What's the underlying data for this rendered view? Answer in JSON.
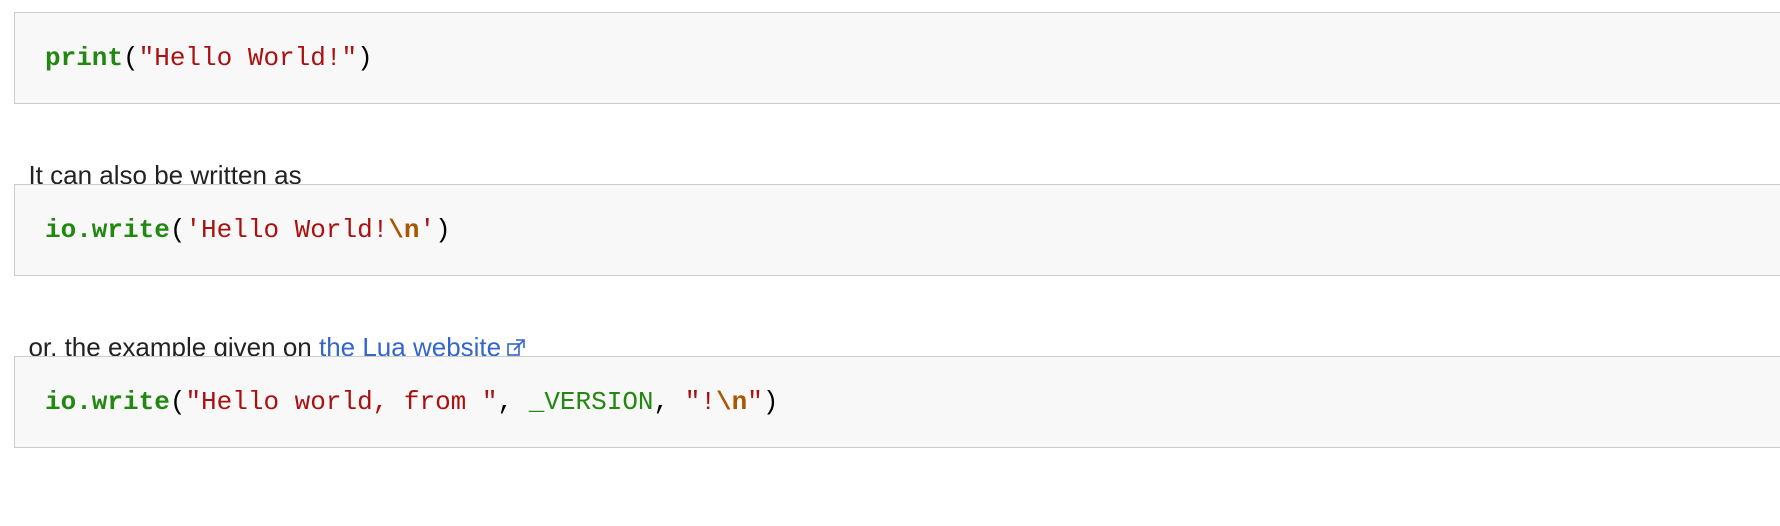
{
  "blocks": {
    "code1": {
      "fn": "print",
      "open": "(",
      "str": "\"Hello World!\"",
      "close": ")"
    },
    "prose1": {
      "text": "It can also be written as"
    },
    "code2": {
      "fn": "io.write",
      "open": "(",
      "str": "'Hello World!",
      "esc": "\\n",
      "str_end": "'",
      "close": ")"
    },
    "prose2": {
      "text": "or, the example given on ",
      "link_text": "the Lua website",
      "link_icon": "external-link-icon"
    },
    "code3": {
      "fn": "io.write",
      "open": "(",
      "str1": "\"Hello world, from \"",
      "comma1": ", ",
      "var": "_VERSION",
      "comma2": ", ",
      "str2_start": "\"!",
      "esc": "\\n",
      "str2_end": "\"",
      "close": ")"
    }
  },
  "colors": {
    "function": "#228811",
    "string": "#aa1111",
    "escape": "#aa5500",
    "link": "#3366cc",
    "code_background": "#f8f8f8",
    "code_border": "#cccccc"
  }
}
